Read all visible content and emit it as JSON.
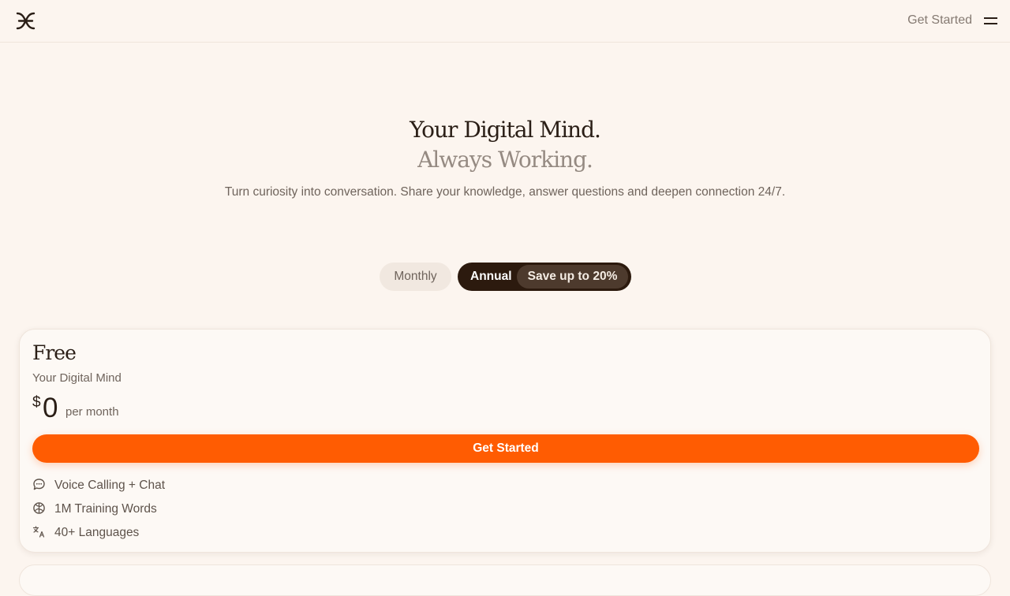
{
  "header": {
    "get_started_label": "Get Started",
    "logo_icon": "brand-logo-icon",
    "menu_icon": "hamburger-menu-icon"
  },
  "hero": {
    "title": "Your Digital Mind.",
    "subtitle": "Always Working.",
    "description": "Turn curiosity into conversation. Share your knowledge, answer questions and deepen connection 24/7."
  },
  "billing_toggle": {
    "monthly_label": "Monthly",
    "annual_label": "Annual",
    "save_badge": "Save up to 20%",
    "selected": "Annual"
  },
  "plans": [
    {
      "name": "Free",
      "tagline": "Your Digital Mind",
      "currency": "$",
      "price": "0",
      "period": "per month",
      "cta_label": "Get Started",
      "features": [
        {
          "icon": "chat-bubble-icon",
          "label": "Voice Calling + Chat"
        },
        {
          "icon": "brain-icon",
          "label": "1M Training Words"
        },
        {
          "icon": "translate-icon",
          "label": "40+ Languages"
        }
      ]
    }
  ],
  "colors": {
    "background": "#fcf5ef",
    "accent": "#ff5c02",
    "toggle_active": "#2c1a0e",
    "text_primary": "#2a1e16",
    "text_muted": "#6f645c"
  }
}
